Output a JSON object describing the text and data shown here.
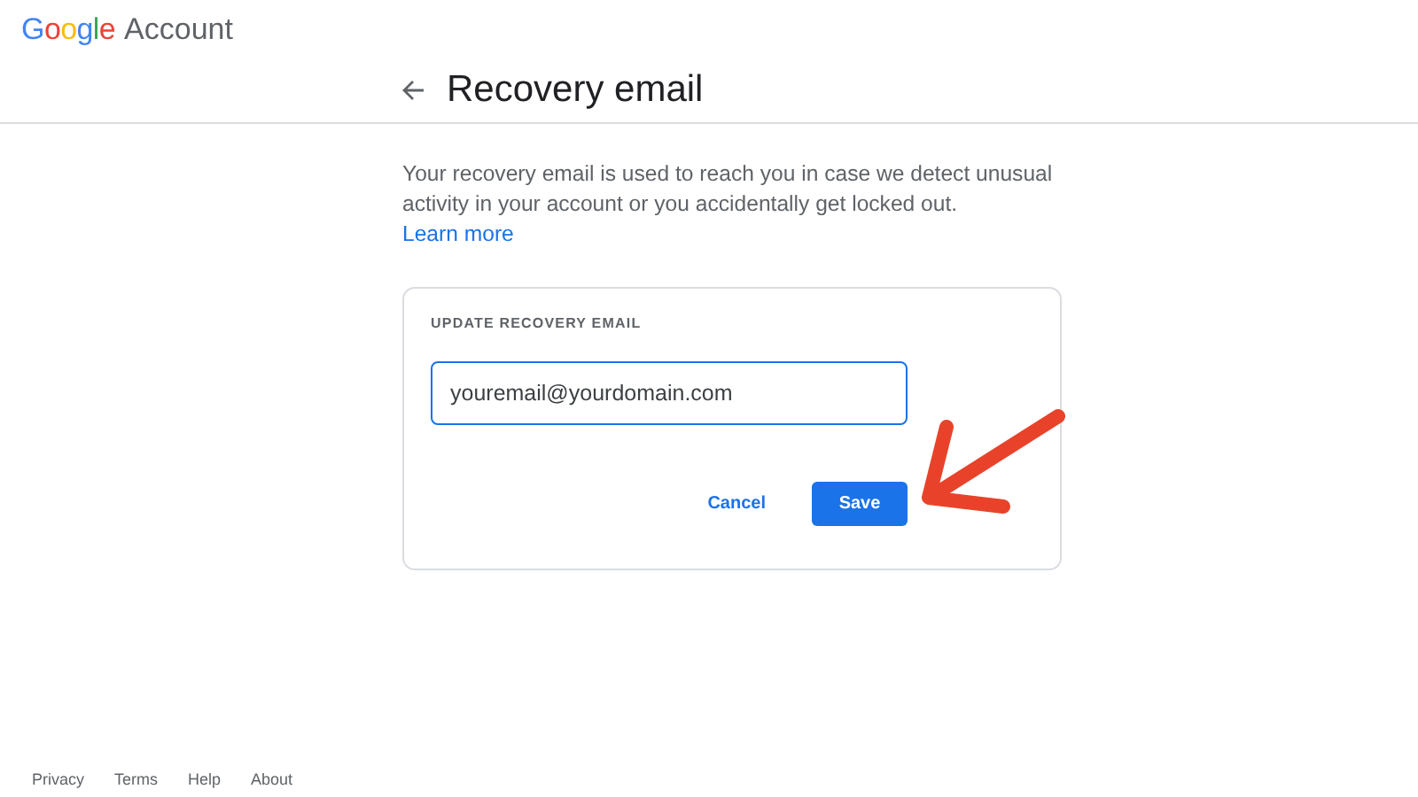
{
  "header": {
    "logo_letters": [
      {
        "text": "G",
        "color": "#4285f4"
      },
      {
        "text": "o",
        "color": "#ea4335"
      },
      {
        "text": "o",
        "color": "#fbbc05"
      },
      {
        "text": "g",
        "color": "#4285f4"
      },
      {
        "text": "l",
        "color": "#34a853"
      },
      {
        "text": "e",
        "color": "#ea4335"
      }
    ],
    "product": "Account"
  },
  "page": {
    "title": "Recovery email",
    "description": "Your recovery email is used to reach you in case we detect unusual activity in your account or you accidentally get locked out.",
    "link": "Learn more"
  },
  "card": {
    "label": "UPDATE RECOVERY EMAIL",
    "email_value": "youremail@yourdomain.com",
    "cancel": "Cancel",
    "save": "Save"
  },
  "footer": {
    "links": [
      "Privacy",
      "Terms",
      "Help",
      "About"
    ]
  }
}
